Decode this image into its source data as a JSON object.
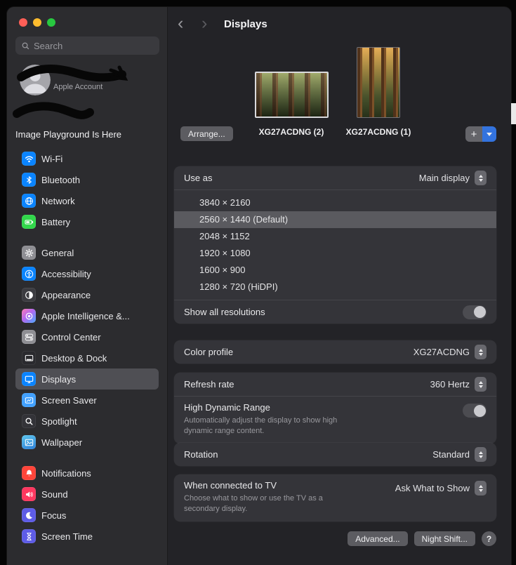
{
  "colors": {
    "accent_blue": "#3373de",
    "traffic_close": "#ff5f57",
    "traffic_min": "#febc2e",
    "traffic_zoom": "#28c840"
  },
  "icons": {
    "back": "‹",
    "forward": "›",
    "add": "+",
    "help": "?"
  },
  "sidebar": {
    "search_placeholder": "Search",
    "account_label": "Apple Account",
    "note": "Image Playground Is Here",
    "items": [
      {
        "label": "Wi-Fi",
        "icon": "wifi",
        "color": "#0a84ff"
      },
      {
        "label": "Bluetooth",
        "icon": "bluetooth",
        "color": "#0a84ff"
      },
      {
        "label": "Network",
        "icon": "network",
        "color": "#0a84ff"
      },
      {
        "label": "Battery",
        "icon": "battery",
        "color": "#32d74b"
      },
      {
        "label": "General",
        "icon": "general",
        "color": "#8e8e93"
      },
      {
        "label": "Accessibility",
        "icon": "accessibility",
        "color": "#0a84ff"
      },
      {
        "label": "Appearance",
        "icon": "appearance",
        "color": "#3c3c41"
      },
      {
        "label": "Apple Intelligence &...",
        "icon": "apple-intelligence",
        "color": "linear-gradient(135deg,#ff7ab5 0%,#b368f0 45%,#4aa8ff 100%)"
      },
      {
        "label": "Control Center",
        "icon": "control-center",
        "color": "#8e8e93"
      },
      {
        "label": "Desktop & Dock",
        "icon": "desktop-dock",
        "color": "#2a2a2e"
      },
      {
        "label": "Displays",
        "icon": "displays",
        "color": "#0a84ff",
        "selected": true
      },
      {
        "label": "Screen Saver",
        "icon": "screen-saver",
        "color": "#41a0fe"
      },
      {
        "label": "Spotlight",
        "icon": "spotlight",
        "color": "#333338"
      },
      {
        "label": "Wallpaper",
        "icon": "wallpaper",
        "color": "linear-gradient(160deg,#5fc7ee,#2b7fd8)"
      },
      {
        "label": "Notifications",
        "icon": "notifications",
        "color": "#ff453a"
      },
      {
        "label": "Sound",
        "icon": "sound",
        "color": "#ff375f"
      },
      {
        "label": "Focus",
        "icon": "focus",
        "color": "#5e5ce6"
      },
      {
        "label": "Screen Time",
        "icon": "screen-time",
        "color": "#5e5ce6"
      }
    ]
  },
  "header": {
    "title": "Displays"
  },
  "display_area": {
    "arrange_button": "Arrange...",
    "displays": [
      {
        "name": "XG27ACDNG (2)"
      },
      {
        "name": "XG27ACDNG (1)"
      }
    ]
  },
  "panels": {
    "use_as": {
      "label": "Use as",
      "value": "Main display"
    },
    "resolutions": {
      "options": [
        "3840 × 2160",
        "2560 × 1440 (Default)",
        "2048 × 1152",
        "1920 × 1080",
        "1600 × 900",
        "1280 × 720 (HiDPI)"
      ],
      "selected": "2560 × 1440 (Default)"
    },
    "show_all": {
      "label": "Show all resolutions",
      "enabled": false
    },
    "color_profile": {
      "label": "Color profile",
      "value": "XG27ACDNG"
    },
    "refresh_rate": {
      "label": "Refresh rate",
      "value": "360 Hertz"
    },
    "hdr": {
      "label": "High Dynamic Range",
      "description": "Automatically adjust the display to show high dynamic range content.",
      "enabled": false
    },
    "rotation": {
      "label": "Rotation",
      "value": "Standard"
    },
    "tv": {
      "label": "When connected to TV",
      "value": "Ask What to Show",
      "description": "Choose what to show or use the TV as a secondary display."
    },
    "advanced_button": "Advanced...",
    "night_shift_button": "Night Shift..."
  }
}
